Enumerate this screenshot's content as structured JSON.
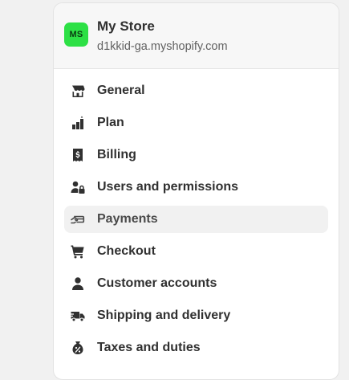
{
  "store": {
    "initials": "MS",
    "name": "My Store",
    "domain": "d1kkid-ga.myshopify.com",
    "avatar_color": "#2de045"
  },
  "nav": {
    "items": [
      {
        "label": "General",
        "icon": "store-icon"
      },
      {
        "label": "Plan",
        "icon": "plan-icon"
      },
      {
        "label": "Billing",
        "icon": "receipt-dollar-icon"
      },
      {
        "label": "Users and permissions",
        "icon": "person-lock-icon"
      },
      {
        "label": "Payments",
        "icon": "hand-card-icon",
        "active": true
      },
      {
        "label": "Checkout",
        "icon": "cart-icon"
      },
      {
        "label": "Customer accounts",
        "icon": "person-icon"
      },
      {
        "label": "Shipping and delivery",
        "icon": "truck-icon"
      },
      {
        "label": "Taxes and duties",
        "icon": "money-bag-percent-icon"
      }
    ]
  },
  "colors": {
    "active_bg": "#f1f1f1",
    "text": "#303030",
    "muted_text": "#616161"
  }
}
